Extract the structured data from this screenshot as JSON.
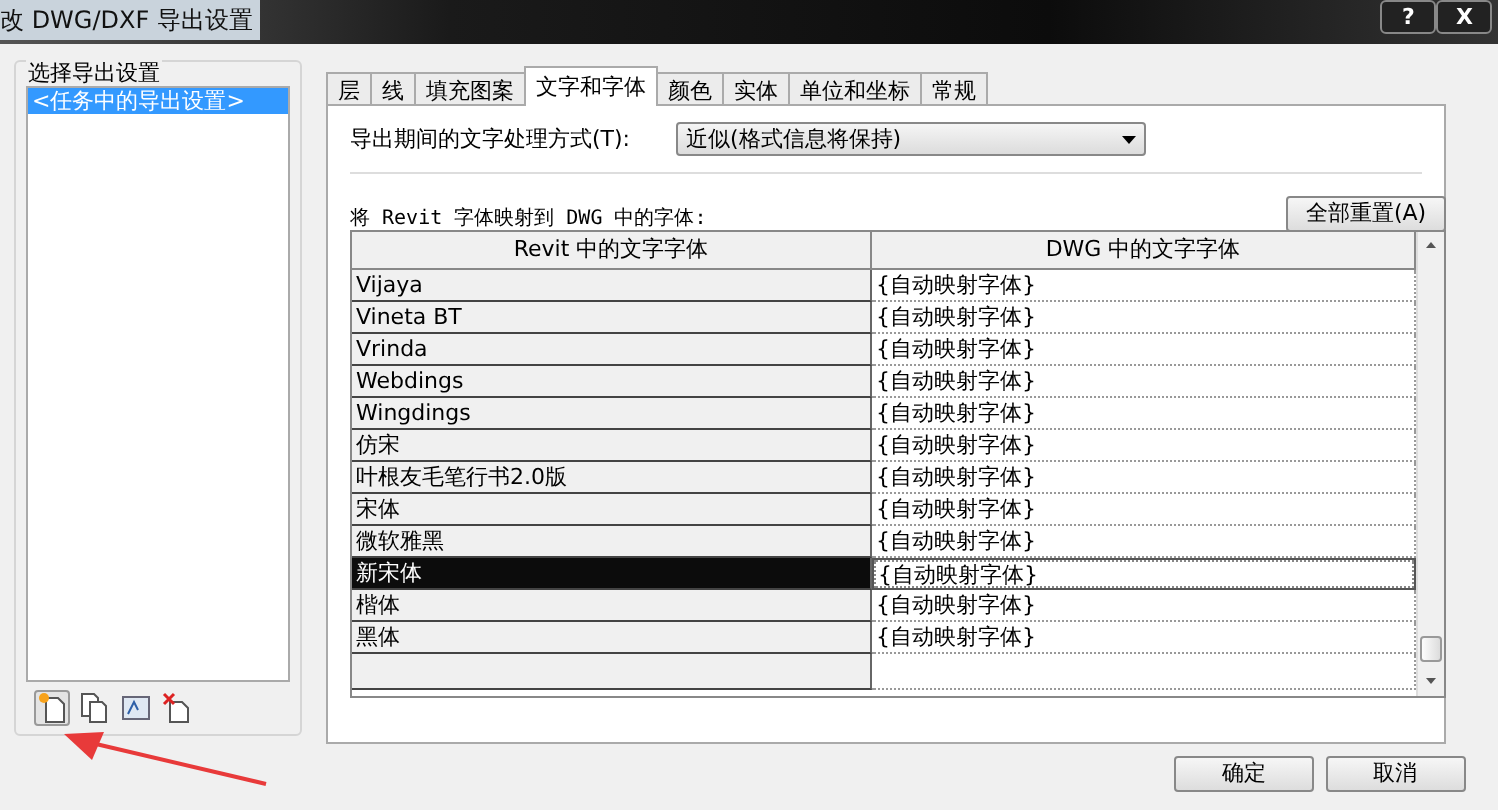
{
  "window": {
    "title": "改 DWG/DXF 导出设置",
    "controls": [
      "?",
      "X"
    ]
  },
  "settings_panel": {
    "label": "选择导出设置",
    "items": [
      {
        "label": "<任务中的导出设置>",
        "selected": true
      }
    ]
  },
  "tabs": [
    {
      "label": "层",
      "selected": false
    },
    {
      "label": "线",
      "selected": false
    },
    {
      "label": "填充图案",
      "selected": false
    },
    {
      "label": "文字和字体",
      "selected": true
    },
    {
      "label": "颜色",
      "selected": false
    },
    {
      "label": "实体",
      "selected": false
    },
    {
      "label": "单位和坐标",
      "selected": false
    },
    {
      "label": "常规",
      "selected": false
    }
  ],
  "text_handling": {
    "label": "导出期间的文字处理方式(T):",
    "value": "近似(格式信息将保持)"
  },
  "mapping_label": "将 Revit 字体映射到 DWG 中的字体:",
  "reset_button": "全部重置(A)",
  "table": {
    "columns": [
      "Revit 中的文字字体",
      "DWG 中的文字字体"
    ],
    "rows": [
      {
        "revit_font": "Vijaya",
        "dwg_font": "{自动映射字体}",
        "selected": false
      },
      {
        "revit_font": "Vineta BT",
        "dwg_font": "{自动映射字体}",
        "selected": false
      },
      {
        "revit_font": "Vrinda",
        "dwg_font": "{自动映射字体}",
        "selected": false
      },
      {
        "revit_font": "Webdings",
        "dwg_font": "{自动映射字体}",
        "selected": false
      },
      {
        "revit_font": "Wingdings",
        "dwg_font": "{自动映射字体}",
        "selected": false
      },
      {
        "revit_font": "仿宋",
        "dwg_font": "{自动映射字体}",
        "selected": false
      },
      {
        "revit_font": "叶根友毛笔行书2.0版",
        "dwg_font": "{自动映射字体}",
        "selected": false
      },
      {
        "revit_font": "宋体",
        "dwg_font": "{自动映射字体}",
        "selected": false
      },
      {
        "revit_font": "微软雅黑",
        "dwg_font": "{自动映射字体}",
        "selected": false
      },
      {
        "revit_font": "新宋体",
        "dwg_font": "{自动映射字体}",
        "selected": true
      },
      {
        "revit_font": "楷体",
        "dwg_font": "{自动映射字体}",
        "selected": false
      },
      {
        "revit_font": "黑体",
        "dwg_font": "{自动映射字体}",
        "selected": false
      }
    ]
  },
  "toolbar": [
    {
      "kind": "new",
      "pressed": true
    },
    {
      "kind": "copy",
      "pressed": false
    },
    {
      "kind": "rename",
      "pressed": false
    },
    {
      "kind": "delete",
      "pressed": false
    }
  ],
  "buttons": [
    "确定",
    "取消"
  ]
}
